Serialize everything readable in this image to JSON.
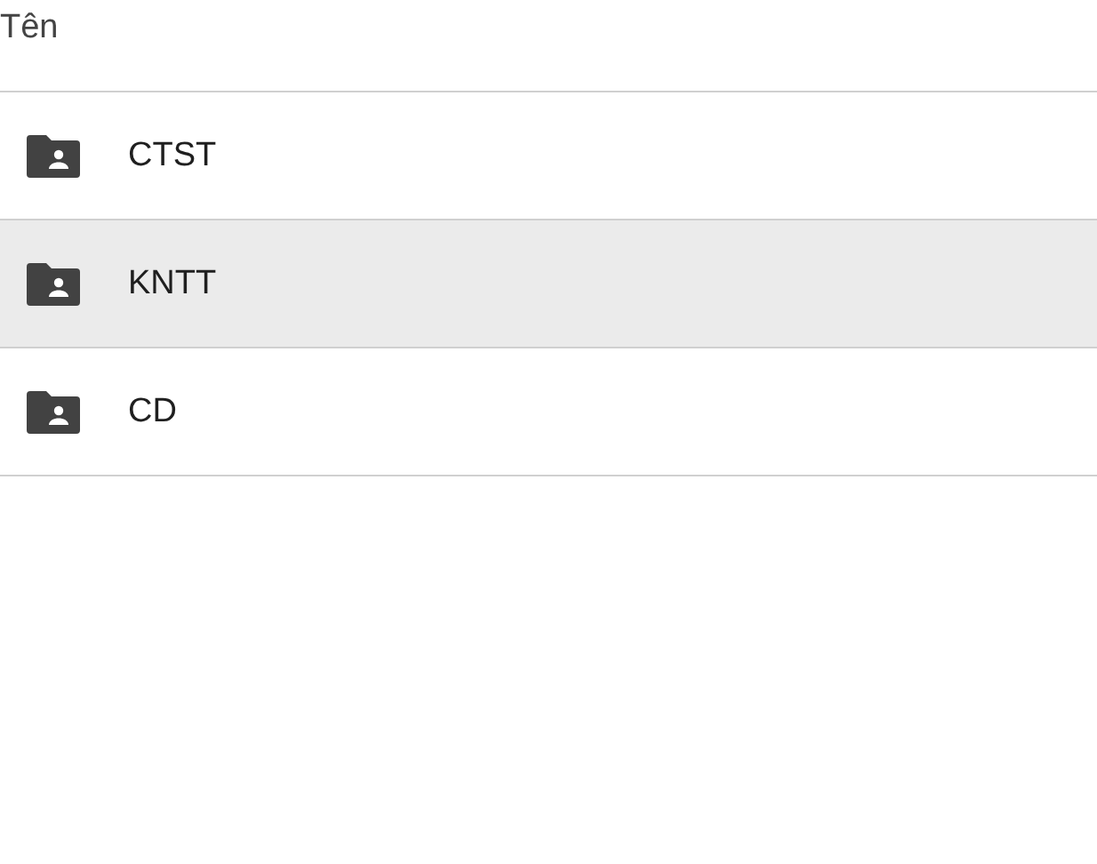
{
  "header": {
    "label": "Tên"
  },
  "rows": [
    {
      "name": "CTST",
      "selected": false
    },
    {
      "name": "KNTT",
      "selected": true
    },
    {
      "name": "CD",
      "selected": false
    }
  ]
}
